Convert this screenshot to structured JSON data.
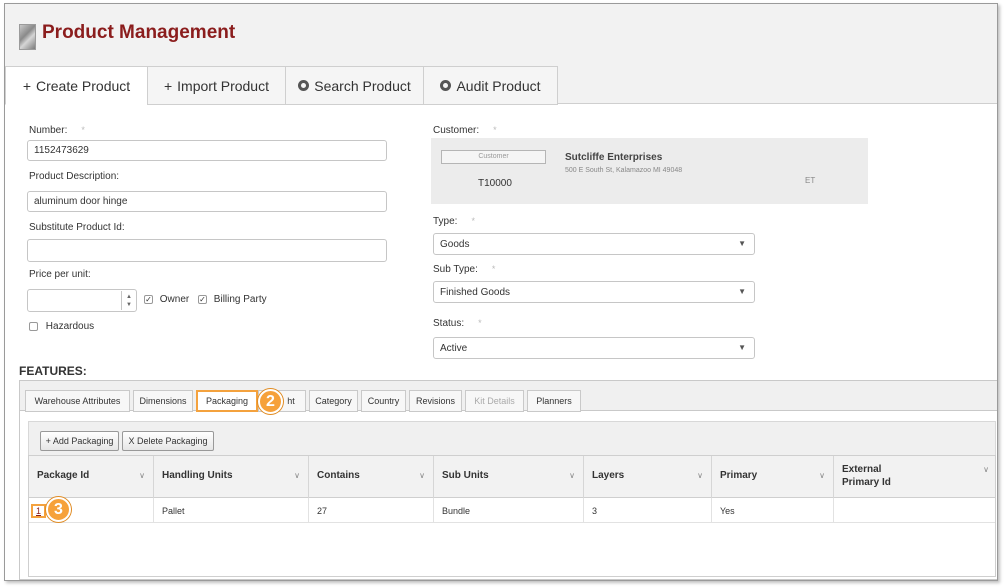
{
  "header": {
    "title": "Product Management",
    "logo_icon": "product-logo-icon"
  },
  "top_tabs": [
    {
      "label": "Create Product",
      "icon": "+"
    },
    {
      "label": "Import Product",
      "icon": "+"
    },
    {
      "label": "Search Product",
      "icon": "radio-icon"
    },
    {
      "label": "Audit Product",
      "icon": "radio-icon"
    }
  ],
  "form": {
    "number_label": "Number:",
    "number_value": "1152473629",
    "description_label": "Product Description:",
    "description_value": "aluminum door hinge",
    "substitute_label": "Substitute Product Id:",
    "substitute_value": "",
    "price_label": "Price per unit:",
    "price_value": "",
    "owner_label": "Owner",
    "billing_label": "Billing Party",
    "hazardous_label": "Hazardous",
    "customer_label": "Customer:",
    "customer_button": "Customer",
    "customer_code": "T10000",
    "customer_name": "Sutcliffe Enterprises",
    "customer_address": "500 E South St, Kalamazoo MI 49048",
    "customer_tz": "ET",
    "type_label": "Type:",
    "type_value": "Goods",
    "subtype_label": "Sub Type:",
    "subtype_value": "Finished Goods",
    "status_label": "Status:",
    "status_value": "Active",
    "required_mark": "*"
  },
  "features": {
    "title": "FEATURES:",
    "tabs": [
      "Warehouse Attributes",
      "Dimensions",
      "Packaging",
      "ht",
      "Category",
      "Country",
      "Revisions",
      "Kit Details",
      "Planners"
    ],
    "active_tab": "Packaging",
    "add_button": "+ Add Packaging",
    "delete_button": "X Delete Packaging",
    "columns": [
      "Package Id",
      "Handling Units",
      "Contains",
      "Sub Units",
      "Layers",
      "Primary",
      "External",
      "Primary Id"
    ],
    "rows": [
      {
        "package_id": "1",
        "handling_units": "Pallet",
        "contains": "27",
        "sub_units": "Bundle",
        "layers": "3",
        "primary": "Yes",
        "external_primary_id": ""
      }
    ],
    "badges": [
      "2",
      "3"
    ]
  },
  "colors": {
    "title": "#8b1d1d",
    "highlight": "#f4a23e"
  }
}
